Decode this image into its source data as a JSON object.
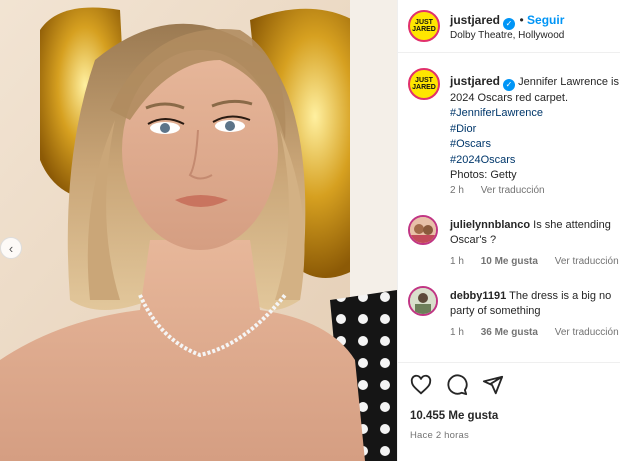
{
  "post": {
    "author": "justjared",
    "follow_label": "Seguir",
    "location": "Dolby Theatre, Hollywood",
    "avatar_text_top": "JUST",
    "avatar_text_bottom": "JARED",
    "caption_text": "Jennifer Lawrence is",
    "caption_line2": "2024 Oscars red carpet.",
    "hashtags": [
      "#JenniferLawrence",
      "#Dior",
      "#Oscars",
      "#2024Oscars"
    ],
    "credit": "Photos: Getty",
    "caption_age": "2 h",
    "translate_label": "Ver traducción"
  },
  "comments": [
    {
      "user": "julielynnblanco",
      "text_line1": "Is she attending",
      "text_line2": "Oscar's ?",
      "age": "1 h",
      "likes": "10 Me gusta",
      "translate": "Ver traducción"
    },
    {
      "user": "debby1191",
      "text_line1": "The dress is a big no",
      "text_line2": "party of something",
      "age": "1 h",
      "likes": "36 Me gusta",
      "translate": "Ver traducción"
    }
  ],
  "footer": {
    "likes_count": "10.455 Me gusta",
    "timestamp": "Hace 2 horas"
  },
  "icons": {
    "like": "heart-icon",
    "comment": "comment-icon",
    "share": "share-icon",
    "verified": "verified-badge-icon",
    "prev": "chevron-left-icon"
  },
  "colors": {
    "accent": "#0095f6",
    "avatar_ring": "#e1306c",
    "avatar_fill": "#ffe600"
  }
}
